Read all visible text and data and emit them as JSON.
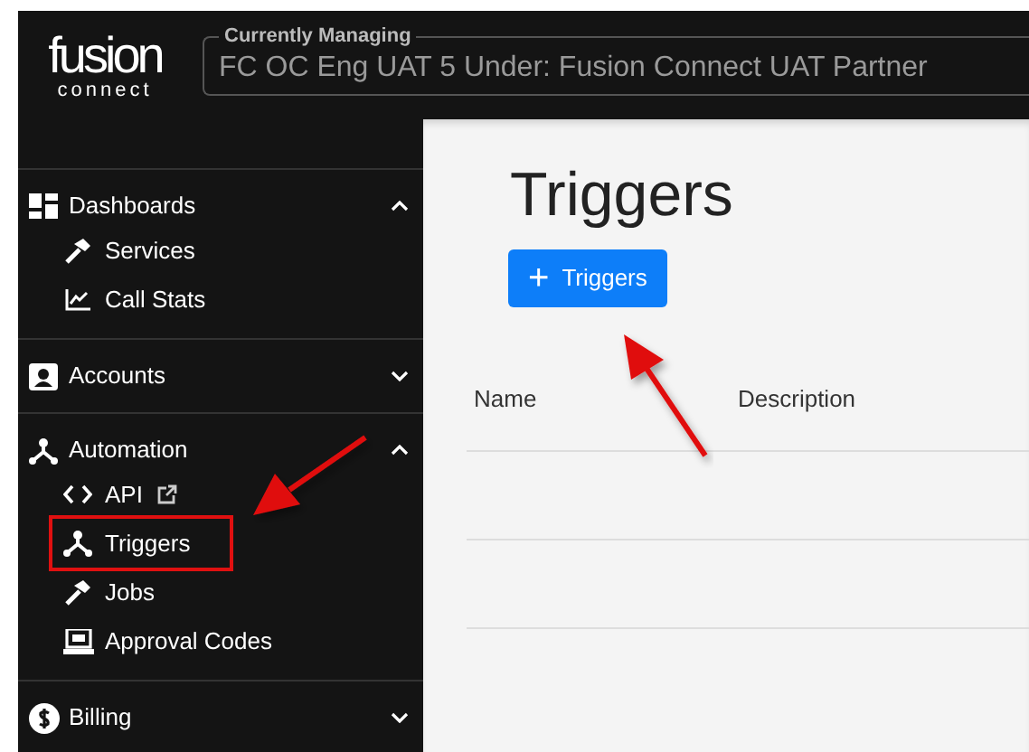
{
  "logo": {
    "name": "fusion",
    "tagline": "connect"
  },
  "managing": {
    "label": "Currently Managing",
    "value": "FC OC Eng UAT 5 Under: Fusion Connect UAT Partner"
  },
  "sidebar": {
    "sections": [
      {
        "label": "Dashboards",
        "expanded": true,
        "items": [
          {
            "label": "Services",
            "highlighted": false,
            "external": false
          },
          {
            "label": "Call Stats",
            "highlighted": false,
            "external": false
          }
        ]
      },
      {
        "label": "Accounts",
        "expanded": false
      },
      {
        "label": "Automation",
        "expanded": true,
        "items": [
          {
            "label": "API",
            "highlighted": false,
            "external": true
          },
          {
            "label": "Triggers",
            "highlighted": true,
            "external": false
          },
          {
            "label": "Jobs",
            "highlighted": false,
            "external": false
          },
          {
            "label": "Approval Codes",
            "highlighted": false,
            "external": false
          }
        ]
      },
      {
        "label": "Billing",
        "expanded": false
      }
    ]
  },
  "page": {
    "title": "Triggers",
    "add_button": {
      "icon": "+",
      "label": "Triggers"
    }
  },
  "table": {
    "columns": [
      "Name",
      "Description"
    ]
  }
}
